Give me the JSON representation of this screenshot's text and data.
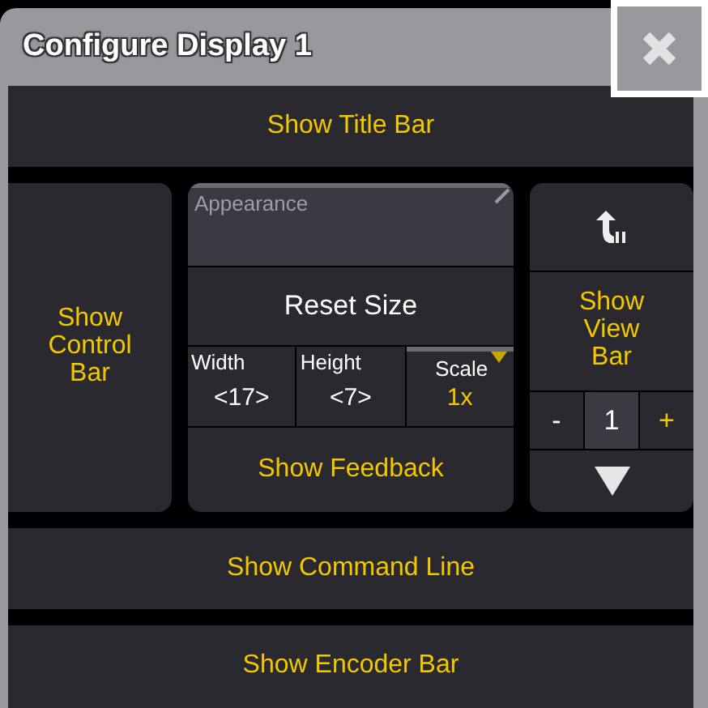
{
  "window": {
    "title": "Configure Display 1"
  },
  "title_bar_toggle": {
    "label": "Show Title Bar",
    "on": true
  },
  "control_bar_toggle": {
    "label": "Show\nControl\nBar",
    "on": true
  },
  "appearance": {
    "title": "Appearance",
    "reset_button": "Reset Size",
    "fields": [
      {
        "kind": "value",
        "label": "Width",
        "value": "<17>"
      },
      {
        "kind": "value",
        "label": "Height",
        "value": "<7>"
      },
      {
        "kind": "dropdown",
        "label": "Scale",
        "value": "1x"
      }
    ],
    "feedback_toggle": {
      "label": "Show Feedback",
      "on": true
    }
  },
  "view_bar": {
    "toggle": {
      "label": "Show\nView\nBar",
      "on": true
    },
    "minus": "-",
    "page": "1",
    "plus": "+"
  },
  "command_line_toggle": {
    "label": "Show Command Line",
    "on": true
  },
  "encoder_bar_toggle": {
    "label": "Show Encoder Bar",
    "on": true
  }
}
